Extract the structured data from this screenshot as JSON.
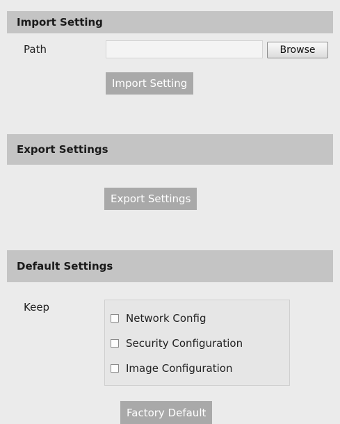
{
  "import": {
    "header": "Import Setting",
    "path_label": "Path",
    "path_value": "",
    "browse_label": "Browse",
    "import_button": "Import Setting"
  },
  "export": {
    "header": "Export Settings",
    "export_button": "Export Settings"
  },
  "default": {
    "header": "Default Settings",
    "keep_label": "Keep",
    "options": [
      {
        "label": "Network Config",
        "checked": false
      },
      {
        "label": "Security Configuration",
        "checked": false
      },
      {
        "label": "Image Configuration",
        "checked": false
      }
    ],
    "factory_button": "Factory Default"
  }
}
